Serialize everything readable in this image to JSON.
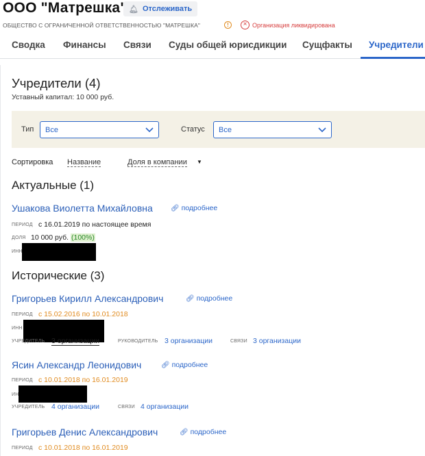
{
  "header": {
    "company_name": "ООО \"Матрешка\"",
    "track_label": "Отслеживать",
    "full_name": "ОБЩЕСТВО С ОГРАНИЧЕННОЙ ОТВЕТСТВЕННОСТЬЮ \"МАТРЕШКА\"",
    "status_text": "Организация ликвидирована",
    "status_color": "#d63c3c"
  },
  "tabs": [
    "Сводка",
    "Финансы",
    "Связи",
    "Суды общей юрисдикции",
    "Сущфакты",
    "Учредители"
  ],
  "active_tab": "Учредители",
  "founders": {
    "title": "Учредители (4)",
    "capital": "Уставный капитал: 10 000 руб.",
    "filters": {
      "type_label": "Тип",
      "type_value": "Все",
      "status_label": "Статус",
      "status_value": "Все"
    },
    "sort": {
      "label": "Сортировка",
      "by_name": "Название",
      "by_share": "Доля в компании"
    },
    "current_title": "Актуальные (1)",
    "historic_title": "Исторические (3)",
    "labels": {
      "more": "подробнее",
      "period": "период",
      "share": "доля",
      "inn": "инн",
      "founder": "учредитель",
      "director": "руководитель",
      "links": "связи"
    },
    "current": [
      {
        "name": "Ушакова Виолетта Михайловна",
        "period": "с 16.01.2019 по настоящее время",
        "share": "10 000 руб.",
        "share_pct": "(100%)"
      }
    ],
    "historic": [
      {
        "name": "Григорьев Кирилл Александрович",
        "period": "с 15.02.2016 по 10.01.2018",
        "founder_of": "3 организации",
        "director_of": "3 организации",
        "links": "3 организации"
      },
      {
        "name": "Ясин Александр Леонидович",
        "period": "с 10.01.2018 по 16.01.2019",
        "founder_of": "4 организации",
        "links": "4 организации"
      },
      {
        "name": "Григорьев Денис Александрович",
        "period": "с 10.01.2018 по 16.01.2019"
      }
    ]
  },
  "colors": {
    "accent": "#2b66c9",
    "orange": "#e08a1e",
    "filter_bg": "#f4f1e6"
  }
}
